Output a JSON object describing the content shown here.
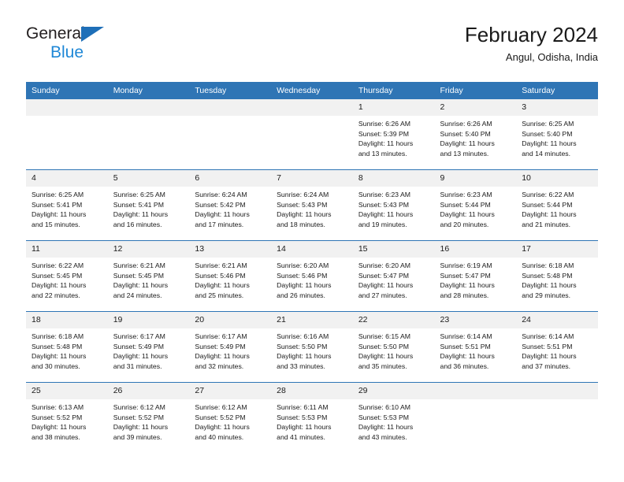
{
  "brand": {
    "name_top": "General",
    "name_bottom": "Blue",
    "triangle_color": "#1e6fb8",
    "blue_text_color": "#1e87d6"
  },
  "header": {
    "title": "February 2024",
    "subtitle": "Angul, Odisha, India"
  },
  "theme": {
    "header_band": "#2f75b5",
    "daynum_strip": "#f1f1f1",
    "row_divider": "#2f75b5",
    "text": "#1a1a1a"
  },
  "weekdays": [
    "Sunday",
    "Monday",
    "Tuesday",
    "Wednesday",
    "Thursday",
    "Friday",
    "Saturday"
  ],
  "labels": {
    "sunrise_prefix": "Sunrise:",
    "sunset_prefix": "Sunset:",
    "daylight_prefix": "Daylight:"
  },
  "weeks": [
    [
      {
        "day": "",
        "sunrise": "",
        "sunset": "",
        "daylight_line1": "",
        "daylight_line2": ""
      },
      {
        "day": "",
        "sunrise": "",
        "sunset": "",
        "daylight_line1": "",
        "daylight_line2": ""
      },
      {
        "day": "",
        "sunrise": "",
        "sunset": "",
        "daylight_line1": "",
        "daylight_line2": ""
      },
      {
        "day": "",
        "sunrise": "",
        "sunset": "",
        "daylight_line1": "",
        "daylight_line2": ""
      },
      {
        "day": "1",
        "sunrise": "Sunrise: 6:26 AM",
        "sunset": "Sunset: 5:39 PM",
        "daylight_line1": "Daylight: 11 hours",
        "daylight_line2": "and 13 minutes."
      },
      {
        "day": "2",
        "sunrise": "Sunrise: 6:26 AM",
        "sunset": "Sunset: 5:40 PM",
        "daylight_line1": "Daylight: 11 hours",
        "daylight_line2": "and 13 minutes."
      },
      {
        "day": "3",
        "sunrise": "Sunrise: 6:25 AM",
        "sunset": "Sunset: 5:40 PM",
        "daylight_line1": "Daylight: 11 hours",
        "daylight_line2": "and 14 minutes."
      }
    ],
    [
      {
        "day": "4",
        "sunrise": "Sunrise: 6:25 AM",
        "sunset": "Sunset: 5:41 PM",
        "daylight_line1": "Daylight: 11 hours",
        "daylight_line2": "and 15 minutes."
      },
      {
        "day": "5",
        "sunrise": "Sunrise: 6:25 AM",
        "sunset": "Sunset: 5:41 PM",
        "daylight_line1": "Daylight: 11 hours",
        "daylight_line2": "and 16 minutes."
      },
      {
        "day": "6",
        "sunrise": "Sunrise: 6:24 AM",
        "sunset": "Sunset: 5:42 PM",
        "daylight_line1": "Daylight: 11 hours",
        "daylight_line2": "and 17 minutes."
      },
      {
        "day": "7",
        "sunrise": "Sunrise: 6:24 AM",
        "sunset": "Sunset: 5:43 PM",
        "daylight_line1": "Daylight: 11 hours",
        "daylight_line2": "and 18 minutes."
      },
      {
        "day": "8",
        "sunrise": "Sunrise: 6:23 AM",
        "sunset": "Sunset: 5:43 PM",
        "daylight_line1": "Daylight: 11 hours",
        "daylight_line2": "and 19 minutes."
      },
      {
        "day": "9",
        "sunrise": "Sunrise: 6:23 AM",
        "sunset": "Sunset: 5:44 PM",
        "daylight_line1": "Daylight: 11 hours",
        "daylight_line2": "and 20 minutes."
      },
      {
        "day": "10",
        "sunrise": "Sunrise: 6:22 AM",
        "sunset": "Sunset: 5:44 PM",
        "daylight_line1": "Daylight: 11 hours",
        "daylight_line2": "and 21 minutes."
      }
    ],
    [
      {
        "day": "11",
        "sunrise": "Sunrise: 6:22 AM",
        "sunset": "Sunset: 5:45 PM",
        "daylight_line1": "Daylight: 11 hours",
        "daylight_line2": "and 22 minutes."
      },
      {
        "day": "12",
        "sunrise": "Sunrise: 6:21 AM",
        "sunset": "Sunset: 5:45 PM",
        "daylight_line1": "Daylight: 11 hours",
        "daylight_line2": "and 24 minutes."
      },
      {
        "day": "13",
        "sunrise": "Sunrise: 6:21 AM",
        "sunset": "Sunset: 5:46 PM",
        "daylight_line1": "Daylight: 11 hours",
        "daylight_line2": "and 25 minutes."
      },
      {
        "day": "14",
        "sunrise": "Sunrise: 6:20 AM",
        "sunset": "Sunset: 5:46 PM",
        "daylight_line1": "Daylight: 11 hours",
        "daylight_line2": "and 26 minutes."
      },
      {
        "day": "15",
        "sunrise": "Sunrise: 6:20 AM",
        "sunset": "Sunset: 5:47 PM",
        "daylight_line1": "Daylight: 11 hours",
        "daylight_line2": "and 27 minutes."
      },
      {
        "day": "16",
        "sunrise": "Sunrise: 6:19 AM",
        "sunset": "Sunset: 5:47 PM",
        "daylight_line1": "Daylight: 11 hours",
        "daylight_line2": "and 28 minutes."
      },
      {
        "day": "17",
        "sunrise": "Sunrise: 6:18 AM",
        "sunset": "Sunset: 5:48 PM",
        "daylight_line1": "Daylight: 11 hours",
        "daylight_line2": "and 29 minutes."
      }
    ],
    [
      {
        "day": "18",
        "sunrise": "Sunrise: 6:18 AM",
        "sunset": "Sunset: 5:48 PM",
        "daylight_line1": "Daylight: 11 hours",
        "daylight_line2": "and 30 minutes."
      },
      {
        "day": "19",
        "sunrise": "Sunrise: 6:17 AM",
        "sunset": "Sunset: 5:49 PM",
        "daylight_line1": "Daylight: 11 hours",
        "daylight_line2": "and 31 minutes."
      },
      {
        "day": "20",
        "sunrise": "Sunrise: 6:17 AM",
        "sunset": "Sunset: 5:49 PM",
        "daylight_line1": "Daylight: 11 hours",
        "daylight_line2": "and 32 minutes."
      },
      {
        "day": "21",
        "sunrise": "Sunrise: 6:16 AM",
        "sunset": "Sunset: 5:50 PM",
        "daylight_line1": "Daylight: 11 hours",
        "daylight_line2": "and 33 minutes."
      },
      {
        "day": "22",
        "sunrise": "Sunrise: 6:15 AM",
        "sunset": "Sunset: 5:50 PM",
        "daylight_line1": "Daylight: 11 hours",
        "daylight_line2": "and 35 minutes."
      },
      {
        "day": "23",
        "sunrise": "Sunrise: 6:14 AM",
        "sunset": "Sunset: 5:51 PM",
        "daylight_line1": "Daylight: 11 hours",
        "daylight_line2": "and 36 minutes."
      },
      {
        "day": "24",
        "sunrise": "Sunrise: 6:14 AM",
        "sunset": "Sunset: 5:51 PM",
        "daylight_line1": "Daylight: 11 hours",
        "daylight_line2": "and 37 minutes."
      }
    ],
    [
      {
        "day": "25",
        "sunrise": "Sunrise: 6:13 AM",
        "sunset": "Sunset: 5:52 PM",
        "daylight_line1": "Daylight: 11 hours",
        "daylight_line2": "and 38 minutes."
      },
      {
        "day": "26",
        "sunrise": "Sunrise: 6:12 AM",
        "sunset": "Sunset: 5:52 PM",
        "daylight_line1": "Daylight: 11 hours",
        "daylight_line2": "and 39 minutes."
      },
      {
        "day": "27",
        "sunrise": "Sunrise: 6:12 AM",
        "sunset": "Sunset: 5:52 PM",
        "daylight_line1": "Daylight: 11 hours",
        "daylight_line2": "and 40 minutes."
      },
      {
        "day": "28",
        "sunrise": "Sunrise: 6:11 AM",
        "sunset": "Sunset: 5:53 PM",
        "daylight_line1": "Daylight: 11 hours",
        "daylight_line2": "and 41 minutes."
      },
      {
        "day": "29",
        "sunrise": "Sunrise: 6:10 AM",
        "sunset": "Sunset: 5:53 PM",
        "daylight_line1": "Daylight: 11 hours",
        "daylight_line2": "and 43 minutes."
      },
      {
        "day": "",
        "sunrise": "",
        "sunset": "",
        "daylight_line1": "",
        "daylight_line2": ""
      },
      {
        "day": "",
        "sunrise": "",
        "sunset": "",
        "daylight_line1": "",
        "daylight_line2": ""
      }
    ]
  ]
}
